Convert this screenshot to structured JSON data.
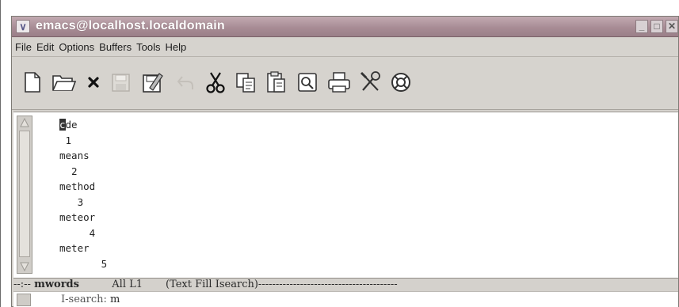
{
  "window": {
    "title": "emacs@localhost.localdomain",
    "menu_icon": "chevron-down-icon",
    "controls": {
      "minimize": "_",
      "maximize": "□",
      "close": "✕"
    }
  },
  "menu": {
    "items": [
      "File",
      "Edit",
      "Options",
      "Buffers",
      "Tools",
      "Help"
    ]
  },
  "toolbar": {
    "buttons": [
      {
        "name": "new-file-icon"
      },
      {
        "name": "open-folder-icon"
      },
      {
        "name": "close-buffer-icon"
      },
      {
        "name": "save-icon"
      },
      {
        "name": "save-as-icon"
      },
      {
        "name": "undo-icon"
      },
      {
        "name": "cut-icon"
      },
      {
        "name": "copy-icon"
      },
      {
        "name": "paste-icon"
      },
      {
        "name": "search-icon"
      },
      {
        "name": "print-icon"
      },
      {
        "name": "preferences-icon"
      },
      {
        "name": "help-icon"
      }
    ]
  },
  "buffer": {
    "cursor_char": "c",
    "first_rest": "de",
    "lines": [
      " 1",
      "means",
      "  2",
      "method",
      "   3",
      "meteor",
      "     4",
      "meter",
      "       5"
    ]
  },
  "modeline": {
    "prefix": "--:-- ",
    "buffer_name": "mwords",
    "position": "All L1",
    "mode": "(Text Fill Isearch)",
    "filler": "----------------------------------------"
  },
  "minibuffer": {
    "prompt": "I-search:",
    "input": "m"
  }
}
